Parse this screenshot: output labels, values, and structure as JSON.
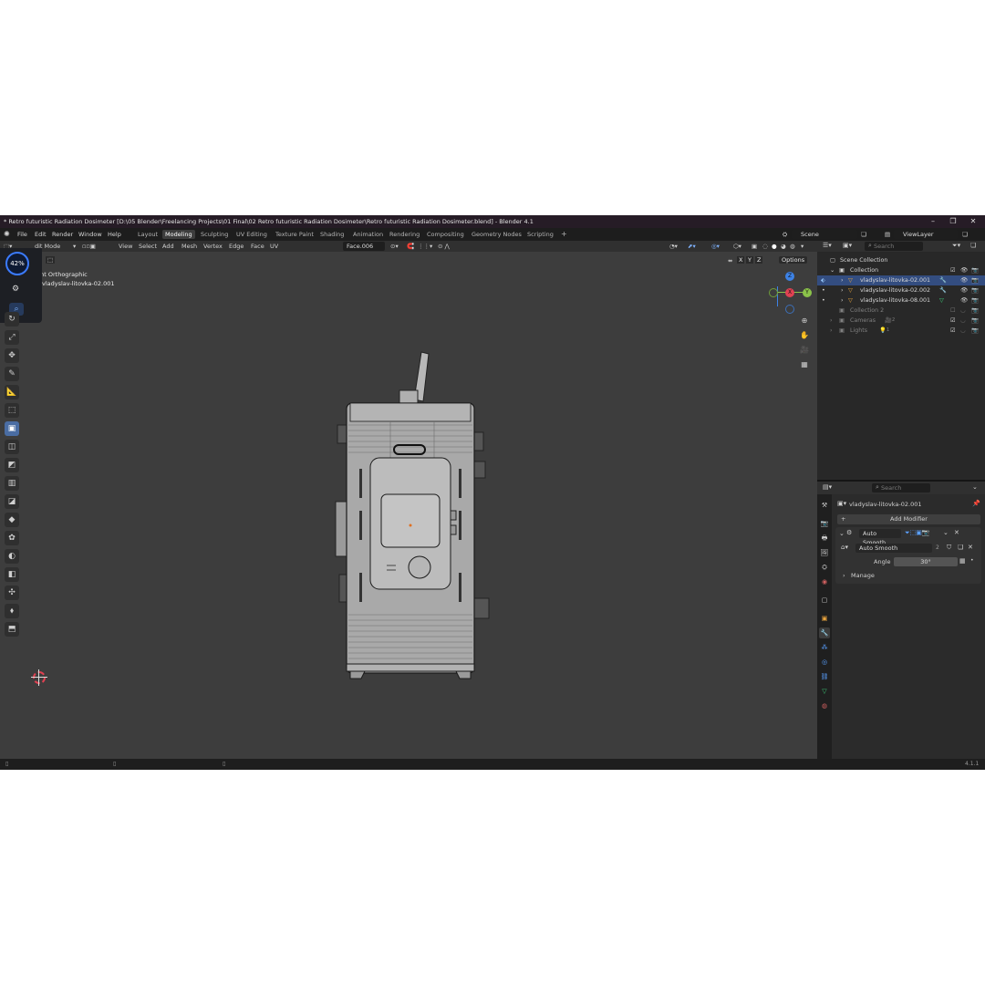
{
  "window": {
    "title": "* Retro futuristic Radiation Dosimeter [D:\\05 Blender\\Freelancing Projects\\01 Final\\02 Retro futuristic Radiation Dosimeter\\Retro futuristic Radiation Dosimeter.blend] - Blender 4.1",
    "min": "–",
    "max": "❐",
    "close": "✕"
  },
  "menu": {
    "file": "File",
    "edit": "Edit",
    "render": "Render",
    "window": "Window",
    "help": "Help",
    "workspaces": [
      "Layout",
      "Modeling",
      "Sculpting",
      "UV Editing",
      "Texture Paint",
      "Shading",
      "Animation",
      "Rendering",
      "Compositing",
      "Geometry Nodes",
      "Scripting"
    ],
    "active_workspace": "Modeling",
    "add_workspace": "+",
    "scene": "Scene",
    "view_layer": "ViewLayer"
  },
  "viewport": {
    "mode": "Edit Mode",
    "mode_partial": "dit Mode",
    "menus": [
      "View",
      "Select",
      "Add",
      "Mesh",
      "Vertex",
      "Edge",
      "Face",
      "UV"
    ],
    "transform_orientation": "Face.006",
    "view_name": "ght Orthographic",
    "object_name": "vladyslav-litovka-02.001",
    "options": "Options",
    "axis_lock": [
      "X",
      "Y",
      "Z"
    ],
    "gizmo": {
      "z": "Z",
      "y": "Y",
      "x": "X"
    },
    "overlay_percent": "42%"
  },
  "outliner": {
    "search_placeholder": "Search",
    "scene_collection": "Scene Collection",
    "collection": "Collection",
    "objects": [
      "vladyslav-litovka-02.001",
      "vladyslav-litovka-02.002",
      "vladyslav-litovka-08.001"
    ],
    "collection2": "Collection 2",
    "cameras": "Cameras",
    "lights": "Lights",
    "cameras_count": "2",
    "lights_count": "1"
  },
  "properties": {
    "search_placeholder": "Search",
    "object_name": "vladyslav-litovka-02.001",
    "add_modifier": "Add Modifier",
    "modifier_name": "Auto Smooth",
    "nodegroup_name": "Auto Smooth",
    "nodegroup_users": "2",
    "angle_label": "Angle",
    "angle_value": "30°",
    "manage": "Manage"
  },
  "status": {
    "version": "4.1.1"
  },
  "colors": {
    "accent": "#4a6da3",
    "selection": "#334d80",
    "axis_x": "#e04152",
    "axis_y": "#8bc34a",
    "axis_z": "#3d82e5",
    "titlebar": "#261c26"
  }
}
